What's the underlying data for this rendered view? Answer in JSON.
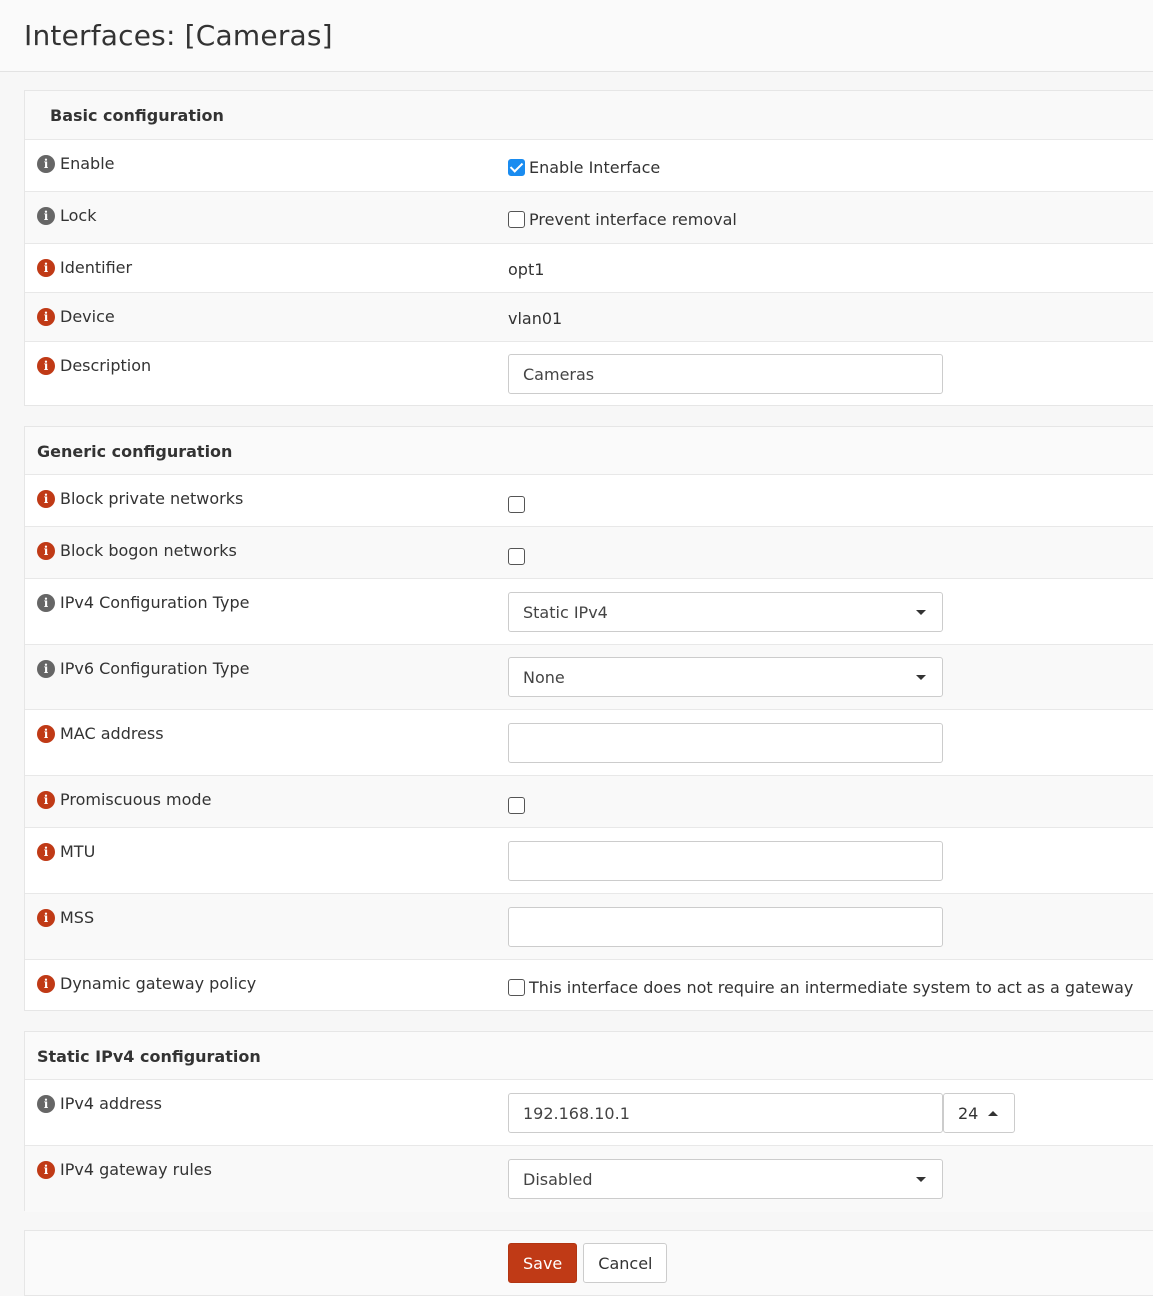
{
  "page": {
    "title": "Interfaces: [Cameras]"
  },
  "basic": {
    "title": "Basic configuration",
    "enable": {
      "label": "Enable",
      "checkbox_label": "Enable Interface",
      "checked": true
    },
    "lock": {
      "label": "Lock",
      "checkbox_label": "Prevent interface removal",
      "checked": false
    },
    "identifier": {
      "label": "Identifier",
      "value": "opt1"
    },
    "device": {
      "label": "Device",
      "value": "vlan01"
    },
    "description": {
      "label": "Description",
      "value": "Cameras"
    }
  },
  "generic": {
    "title": "Generic configuration",
    "block_private": {
      "label": "Block private networks",
      "checked": false
    },
    "block_bogon": {
      "label": "Block bogon networks",
      "checked": false
    },
    "ipv4_type": {
      "label": "IPv4 Configuration Type",
      "value": "Static IPv4"
    },
    "ipv6_type": {
      "label": "IPv6 Configuration Type",
      "value": "None"
    },
    "mac": {
      "label": "MAC address",
      "value": ""
    },
    "promisc": {
      "label": "Promiscuous mode",
      "checked": false
    },
    "mtu": {
      "label": "MTU",
      "value": ""
    },
    "mss": {
      "label": "MSS",
      "value": ""
    },
    "dyn_gw": {
      "label": "Dynamic gateway policy",
      "checkbox_label": "This interface does not require an intermediate system to act as a gateway",
      "checked": false
    }
  },
  "static_ipv4": {
    "title": "Static IPv4 configuration",
    "address": {
      "label": "IPv4 address",
      "value": "192.168.10.1",
      "subnet": "24"
    },
    "gateway_rules": {
      "label": "IPv4 gateway rules",
      "value": "Disabled"
    }
  },
  "actions": {
    "save_label": "Save",
    "cancel_label": "Cancel"
  },
  "colors": {
    "accent": "#c03a16",
    "checkbox_checked": "#1a8cf0",
    "info_gray": "#666666"
  }
}
